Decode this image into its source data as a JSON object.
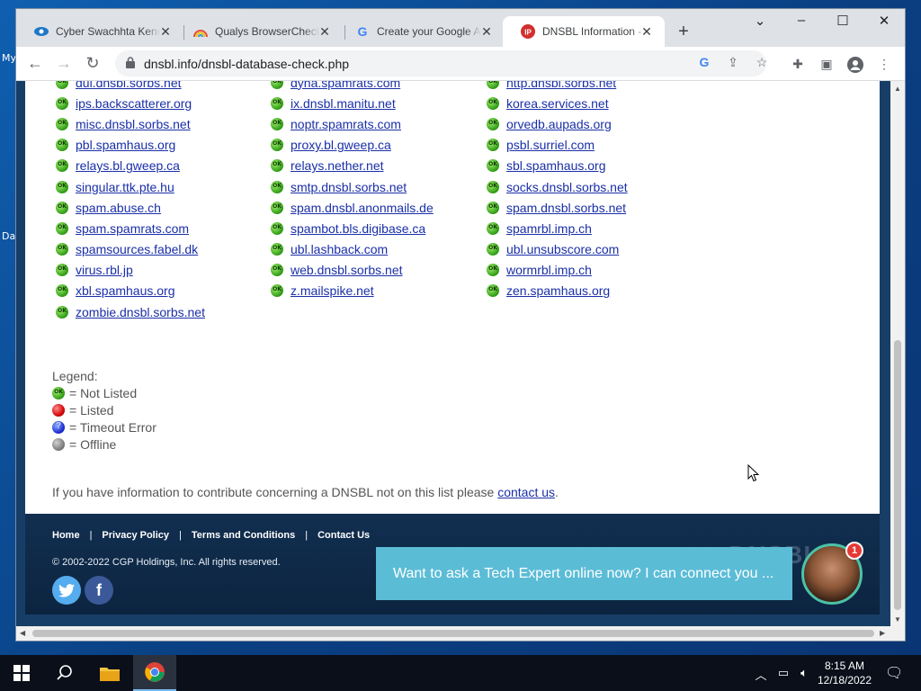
{
  "desktop": {
    "label_my": "My",
    "label_da": "Da"
  },
  "browser": {
    "tabs": [
      {
        "title": "Cyber Swachhta Kendr",
        "close": "✕"
      },
      {
        "title": "Qualys BrowserCheck",
        "close": "✕"
      },
      {
        "title": "Create your Google A",
        "close": "✕"
      },
      {
        "title": "DNSBL Information -",
        "close": "✕"
      }
    ],
    "new_tab": "+",
    "url": "dnsbl.info/dnsbl-database-check.php"
  },
  "page": {
    "columns": [
      [
        "dul.dnsbl.sorbs.net",
        "ips.backscatterer.org",
        "misc.dnsbl.sorbs.net",
        "pbl.spamhaus.org",
        "relays.bl.gweep.ca",
        "singular.ttk.pte.hu",
        "spam.abuse.ch",
        "spam.spamrats.com",
        "spamsources.fabel.dk",
        "virus.rbl.jp",
        "xbl.spamhaus.org",
        "zombie.dnsbl.sorbs.net"
      ],
      [
        "dyna.spamrats.com",
        "ix.dnsbl.manitu.net",
        "noptr.spamrats.com",
        "proxy.bl.gweep.ca",
        "relays.nether.net",
        "smtp.dnsbl.sorbs.net",
        "spam.dnsbl.anonmails.de",
        "spambot.bls.digibase.ca",
        "ubl.lashback.com",
        "web.dnsbl.sorbs.net",
        "z.mailspike.net"
      ],
      [
        "http.dnsbl.sorbs.net",
        "korea.services.net",
        "orvedb.aupads.org",
        "psbl.surriel.com",
        "sbl.spamhaus.org",
        "socks.dnsbl.sorbs.net",
        "spam.dnsbl.sorbs.net",
        "spamrbl.imp.ch",
        "ubl.unsubscore.com",
        "wormrbl.imp.ch",
        "zen.spamhaus.org"
      ]
    ],
    "legend": {
      "title": "Legend:",
      "items": [
        {
          "status": "ok",
          "label": "= Not Listed"
        },
        {
          "status": "red",
          "label": "= Listed"
        },
        {
          "status": "blue",
          "label": "= Timeout Error"
        },
        {
          "status": "gray",
          "label": "= Offline"
        }
      ]
    },
    "info_text": "If you have information to contribute concerning a DNSBL not on this list please ",
    "info_link": "contact us",
    "info_end": "."
  },
  "footer": {
    "nav": [
      "Home",
      "Privacy Policy",
      "Terms and Conditions",
      "Contact Us"
    ],
    "copyright": "© 2002-2022 CGP Holdings, Inc. All rights reserved.",
    "logo": "DNSBL"
  },
  "chat": {
    "message": "Want to ask a Tech Expert online now? I can connect you ...",
    "badge": "1"
  },
  "taskbar": {
    "time": "8:15 AM",
    "date": "12/18/2022"
  },
  "colors": {
    "status_ok": "#2f9a14",
    "status_listed": "#d10000",
    "status_timeout": "#1b2ccf",
    "status_offline": "#7b7b7b",
    "link": "#1a2fa8",
    "chat": "#5bbcd6"
  }
}
